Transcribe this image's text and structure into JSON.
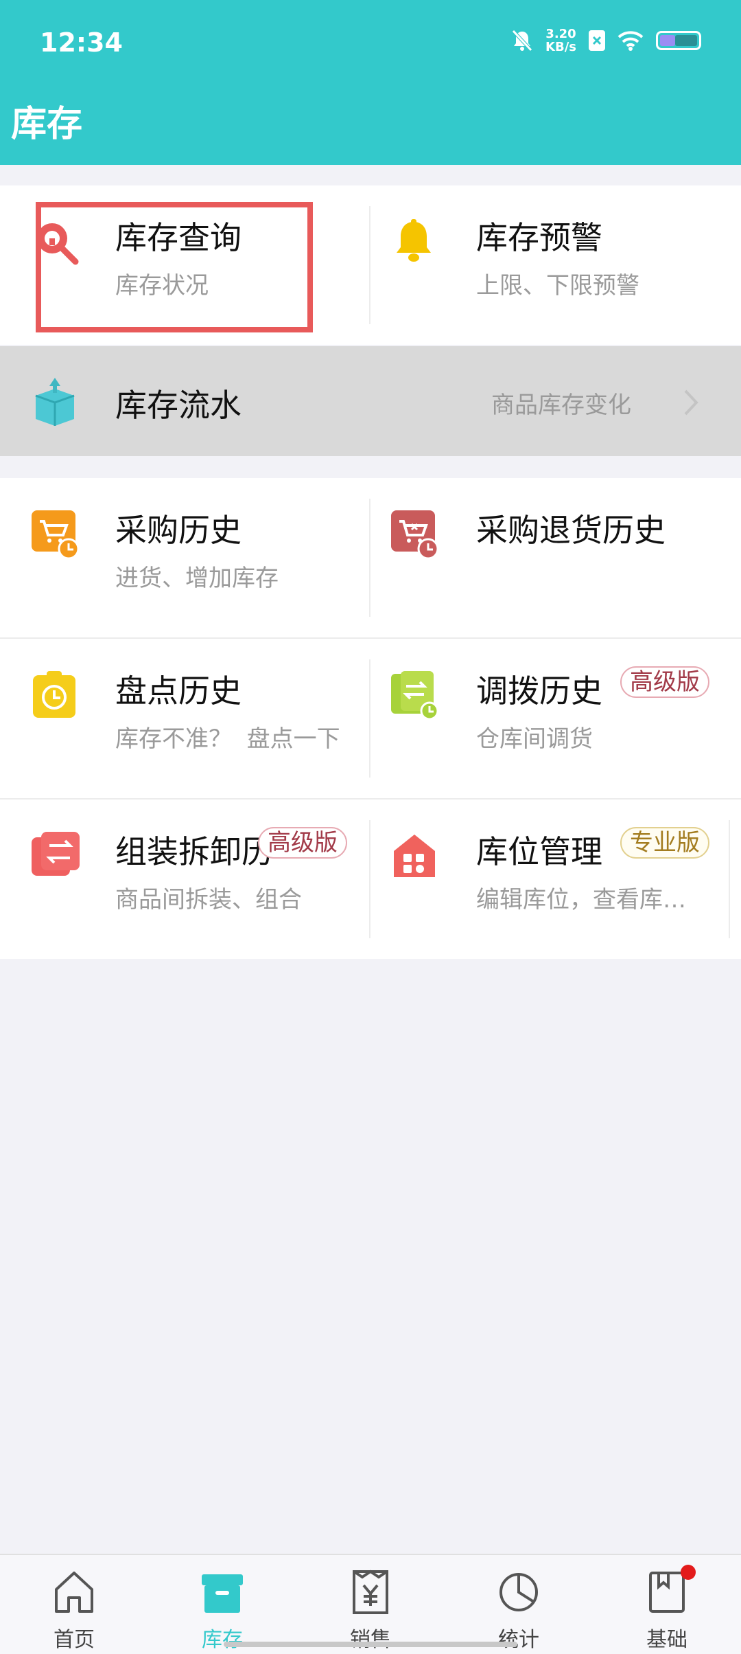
{
  "status_bar": {
    "time": "12:34",
    "net_speed_value": "3.20",
    "net_speed_unit": "KB/s"
  },
  "header": {
    "title": "库存"
  },
  "menu": {
    "stock_query": {
      "title": "库存查询",
      "subtitle": "库存状况",
      "icon": "magnifier-icon"
    },
    "stock_warning": {
      "title": "库存预警",
      "subtitle": "上限、下限预警",
      "icon": "bell-icon"
    },
    "stock_flow": {
      "title": "库存流水",
      "subtitle": "商品库存变化",
      "icon": "box-upload-icon"
    },
    "purchase_history": {
      "title": "采购历史",
      "subtitle": "进货、增加库存",
      "icon": "cart-clock-icon"
    },
    "purchase_return_history": {
      "title": "采购退货历史",
      "subtitle": "",
      "icon": "cart-x-clock-icon"
    },
    "inventory_check_history": {
      "title": "盘点历史",
      "subtitle": "库存不准？  盘点一下",
      "icon": "clipboard-clock-icon"
    },
    "transfer_history": {
      "title": "调拨历史",
      "subtitle": "仓库间调货",
      "badge": "高级版",
      "icon": "transfer-clock-icon"
    },
    "assembly": {
      "title": "组装拆卸历",
      "subtitle": "商品间拆装、组合",
      "badge": "高级版",
      "icon": "swap-icon"
    },
    "location_mgmt": {
      "title": "库位管理",
      "subtitle": "编辑库位，查看库…",
      "badge": "专业版",
      "icon": "warehouse-icon"
    }
  },
  "tabbar": {
    "items": [
      {
        "label": "首页",
        "icon": "home-icon"
      },
      {
        "label": "库存",
        "icon": "inventory-box-icon"
      },
      {
        "label": "销售",
        "icon": "yen-receipt-icon"
      },
      {
        "label": "统计",
        "icon": "pie-chart-icon"
      },
      {
        "label": "基础",
        "icon": "book-icon"
      }
    ],
    "active_index": 1
  },
  "colors": {
    "accent": "#33c9cb",
    "highlight_box": "#e85a5a",
    "badge_red": "#a23a48",
    "badge_gold": "#a37c1f"
  }
}
